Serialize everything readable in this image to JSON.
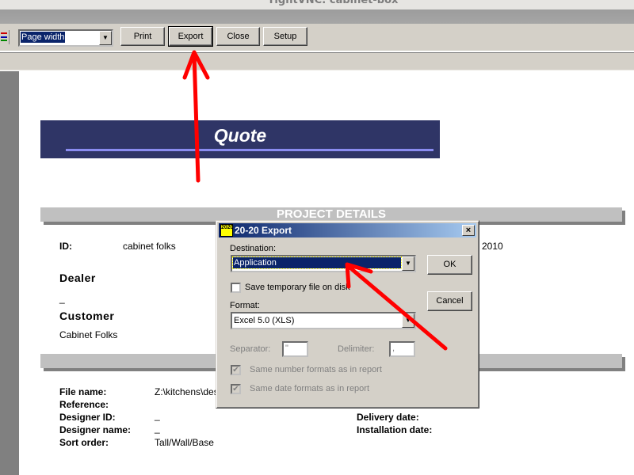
{
  "window": {
    "title": "TightVNC: cabinet-box"
  },
  "toolbar": {
    "zoom_value": "Page width",
    "print": "Print",
    "export": "Export",
    "close": "Close",
    "setup": "Setup"
  },
  "report": {
    "title": "Quote",
    "section_project": "PROJECT DETAILS",
    "id_label": "ID:",
    "id_value": "cabinet folks",
    "date_partial": "2010",
    "dealer_heading": "Dealer",
    "dealer_value": "_",
    "customer_heading": "Customer",
    "customer_value": "Cabinet Folks",
    "fields": [
      {
        "label": "File name:",
        "value": "Z:\\kitchens\\des"
      },
      {
        "label": "Reference:",
        "value": ""
      },
      {
        "label": "Designer ID:",
        "value": "_"
      },
      {
        "label": "Designer name:",
        "value": "_"
      },
      {
        "label": "Sort order:",
        "value": "Tall/Wall/Base"
      }
    ],
    "dates": [
      {
        "label": "Delivery date:"
      },
      {
        "label": "Installation date:"
      }
    ]
  },
  "dialog": {
    "title": "20-20 Export",
    "icon_text": "2020",
    "destination_label": "Destination:",
    "destination_value": "Application",
    "save_temp_label": "Save temporary file on disk",
    "format_label": "Format:",
    "format_value": "Excel 5.0 (XLS)",
    "separator_label": "Separator:",
    "separator_value": "\"",
    "delimiter_label": "Delimiter:",
    "delimiter_value": ",",
    "same_number_label": "Same number formats as in report",
    "same_date_label": "Same date formats as in report",
    "ok": "OK",
    "cancel": "Cancel",
    "close": "×"
  },
  "colors": {
    "banner": "#2f3566",
    "annotation": "#ff0000",
    "dialog_title": "#0a246a"
  }
}
